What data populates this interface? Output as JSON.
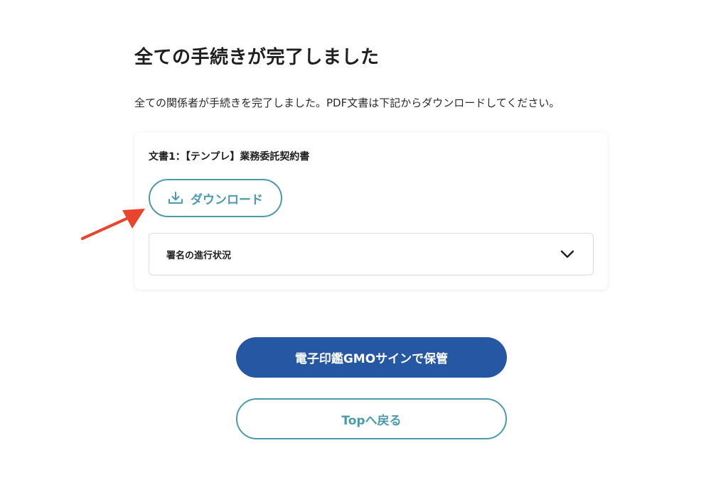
{
  "page": {
    "title": "全ての手続きが完了しました",
    "description": "全ての関係者が手続きを完了しました。PDF文書は下記からダウンロードしてください。"
  },
  "document_card": {
    "document_name": "文書1：【テンプレ】業務委託契約書",
    "download_label": "ダウンロード",
    "download_icon": "download-icon",
    "progress_label": "署名の進行状況",
    "progress_icon": "chevron-down-icon"
  },
  "annotation": {
    "arrow_icon": "red-arrow-icon",
    "color": "#e8452c"
  },
  "actions": {
    "save_label": "電子印鑑GMOサインで保管",
    "back_label": "Topへ戻る"
  },
  "colors": {
    "primary": "#2557a2",
    "accent": "#4a9bab"
  }
}
